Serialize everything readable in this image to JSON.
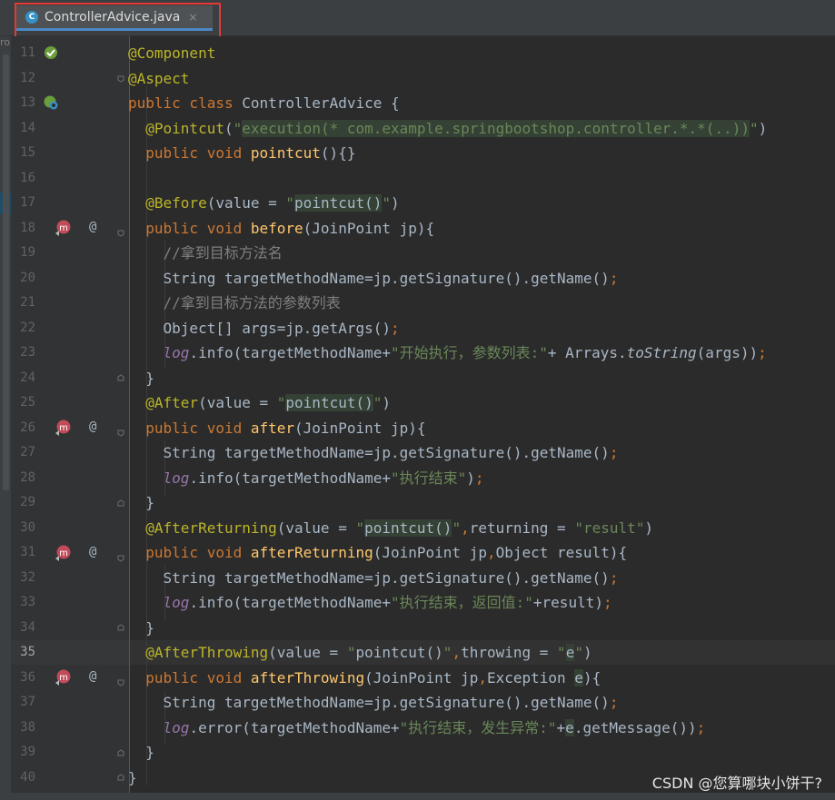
{
  "tab": {
    "icon_letter": "C",
    "label": "ControllerAdvice.java",
    "close": "×"
  },
  "side": {
    "label": "ro"
  },
  "lines": [
    {
      "n": "11",
      "tokens": [
        [
          "an",
          "@Component"
        ]
      ]
    },
    {
      "n": "12",
      "tokens": [
        [
          "an",
          "@Aspect"
        ]
      ]
    },
    {
      "n": "13",
      "tokens": [
        [
          "kw",
          "public class "
        ],
        [
          "",
          "ControllerAdvice {"
        ]
      ]
    },
    {
      "n": "14",
      "tokens": [
        [
          "",
          "  "
        ],
        [
          "an",
          "@Pointcut"
        ],
        [
          "",
          "("
        ],
        [
          "st",
          "\""
        ],
        [
          "st hl",
          "execution(* com.example.springbootshop.controller.*.*(..))"
        ],
        [
          "st",
          "\""
        ],
        [
          "",
          ")"
        ]
      ]
    },
    {
      "n": "15",
      "tokens": [
        [
          "",
          "  "
        ],
        [
          "kw",
          "public void "
        ],
        [
          "fn",
          "pointcut"
        ],
        [
          "",
          "(){}"
        ]
      ]
    },
    {
      "n": "16",
      "tokens": []
    },
    {
      "n": "17",
      "tokens": [
        [
          "",
          "  "
        ],
        [
          "an",
          "@Before"
        ],
        [
          "",
          "(value = "
        ],
        [
          "st",
          "\""
        ],
        [
          "hl",
          "pointcut()"
        ],
        [
          "st",
          "\""
        ],
        [
          "",
          ")"
        ]
      ]
    },
    {
      "n": "18",
      "tokens": [
        [
          "",
          "  "
        ],
        [
          "kw",
          "public void "
        ],
        [
          "fn",
          "before"
        ],
        [
          "",
          "(JoinPoint jp){"
        ]
      ]
    },
    {
      "n": "19",
      "tokens": [
        [
          "",
          "    "
        ],
        [
          "cm",
          "//拿到目标方法名"
        ]
      ]
    },
    {
      "n": "20",
      "tokens": [
        [
          "",
          "    String targetMethodName=jp.getSignature().getName()"
        ],
        [
          "kw",
          ";"
        ]
      ]
    },
    {
      "n": "21",
      "tokens": [
        [
          "",
          "    "
        ],
        [
          "cm",
          "//拿到目标方法的参数列表"
        ]
      ]
    },
    {
      "n": "22",
      "tokens": [
        [
          "",
          "    Object[] args=jp.getArgs()"
        ],
        [
          "kw",
          ";"
        ]
      ]
    },
    {
      "n": "23",
      "tokens": [
        [
          "",
          "    "
        ],
        [
          "fld",
          "log"
        ],
        [
          "",
          ".info(targetMethodName+"
        ],
        [
          "st",
          "\"开始执行，参数列表:\""
        ],
        [
          "",
          "+ Arrays."
        ],
        [
          "it",
          "toString"
        ],
        [
          "",
          "(args))"
        ],
        [
          "kw",
          ";"
        ]
      ]
    },
    {
      "n": "24",
      "tokens": [
        [
          "",
          "  }"
        ]
      ]
    },
    {
      "n": "25",
      "tokens": [
        [
          "",
          "  "
        ],
        [
          "an",
          "@After"
        ],
        [
          "",
          "(value = "
        ],
        [
          "st",
          "\""
        ],
        [
          "hl",
          "pointcut()"
        ],
        [
          "st",
          "\""
        ],
        [
          "",
          ")"
        ]
      ]
    },
    {
      "n": "26",
      "tokens": [
        [
          "",
          "  "
        ],
        [
          "kw",
          "public void "
        ],
        [
          "fn",
          "after"
        ],
        [
          "",
          "(JoinPoint jp){"
        ]
      ]
    },
    {
      "n": "27",
      "tokens": [
        [
          "",
          "    String targetMethodName=jp.getSignature().getName()"
        ],
        [
          "kw",
          ";"
        ]
      ]
    },
    {
      "n": "28",
      "tokens": [
        [
          "",
          "    "
        ],
        [
          "fld",
          "log"
        ],
        [
          "",
          ".info(targetMethodName+"
        ],
        [
          "st",
          "\"执行结束\""
        ],
        [
          "",
          ")"
        ],
        [
          "kw",
          ";"
        ]
      ]
    },
    {
      "n": "29",
      "tokens": [
        [
          "",
          "  }"
        ]
      ]
    },
    {
      "n": "30",
      "tokens": [
        [
          "",
          "  "
        ],
        [
          "an",
          "@AfterReturning"
        ],
        [
          "",
          "(value = "
        ],
        [
          "st",
          "\""
        ],
        [
          "hl",
          "pointcut()"
        ],
        [
          "st",
          "\""
        ],
        [
          "kw",
          ","
        ],
        [
          "",
          "returning = "
        ],
        [
          "st",
          "\"result\""
        ],
        [
          "",
          ")"
        ]
      ]
    },
    {
      "n": "31",
      "tokens": [
        [
          "",
          "  "
        ],
        [
          "kw",
          "public void "
        ],
        [
          "fn",
          "afterReturning"
        ],
        [
          "",
          "(JoinPoint jp"
        ],
        [
          "kw",
          ","
        ],
        [
          "",
          "Object result){"
        ]
      ]
    },
    {
      "n": "32",
      "tokens": [
        [
          "",
          "    String targetMethodName=jp.getSignature().getName()"
        ],
        [
          "kw",
          ";"
        ]
      ]
    },
    {
      "n": "33",
      "tokens": [
        [
          "",
          "    "
        ],
        [
          "fld",
          "log"
        ],
        [
          "",
          ".info(targetMethodName+"
        ],
        [
          "st",
          "\"执行结束，返回值:\""
        ],
        [
          "",
          "+result)"
        ],
        [
          "kw",
          ";"
        ]
      ]
    },
    {
      "n": "34",
      "tokens": [
        [
          "",
          "  }"
        ]
      ]
    },
    {
      "n": "35",
      "tokens": [
        [
          "",
          "  "
        ],
        [
          "an",
          "@AfterThrowing"
        ],
        [
          "",
          "(value = "
        ],
        [
          "st",
          "\""
        ],
        [
          "",
          "pointcut()"
        ],
        [
          "st",
          "\""
        ],
        [
          "kw",
          ","
        ],
        [
          "",
          "throwing = "
        ],
        [
          "st",
          "\""
        ],
        [
          "hl",
          "e"
        ],
        [
          "st",
          "\""
        ],
        [
          "",
          ")"
        ]
      ]
    },
    {
      "n": "36",
      "tokens": [
        [
          "",
          "  "
        ],
        [
          "kw",
          "public void "
        ],
        [
          "fn",
          "afterThrowing"
        ],
        [
          "",
          "(JoinPoint jp"
        ],
        [
          "kw",
          ","
        ],
        [
          "",
          "Exception "
        ],
        [
          "hl",
          "e"
        ],
        [
          "",
          "){"
        ]
      ]
    },
    {
      "n": "37",
      "tokens": [
        [
          "",
          "    String targetMethodName=jp.getSignature().getName()"
        ],
        [
          "kw",
          ";"
        ]
      ]
    },
    {
      "n": "38",
      "tokens": [
        [
          "",
          "    "
        ],
        [
          "fld",
          "log"
        ],
        [
          "",
          ".error(targetMethodName+"
        ],
        [
          "st",
          "\"执行结束，发生异常:\""
        ],
        [
          "",
          "+"
        ],
        [
          "hl",
          "e"
        ],
        [
          "",
          ".getMessage())"
        ],
        [
          "kw",
          ";"
        ]
      ]
    },
    {
      "n": "39",
      "tokens": [
        [
          "",
          "  }"
        ]
      ]
    },
    {
      "n": "40",
      "tokens": [
        [
          "",
          "}"
        ]
      ]
    }
  ],
  "gutter": {
    "at_symbol": "@",
    "current_line": "35"
  },
  "watermark": "CSDN @您算哪块小饼干?"
}
